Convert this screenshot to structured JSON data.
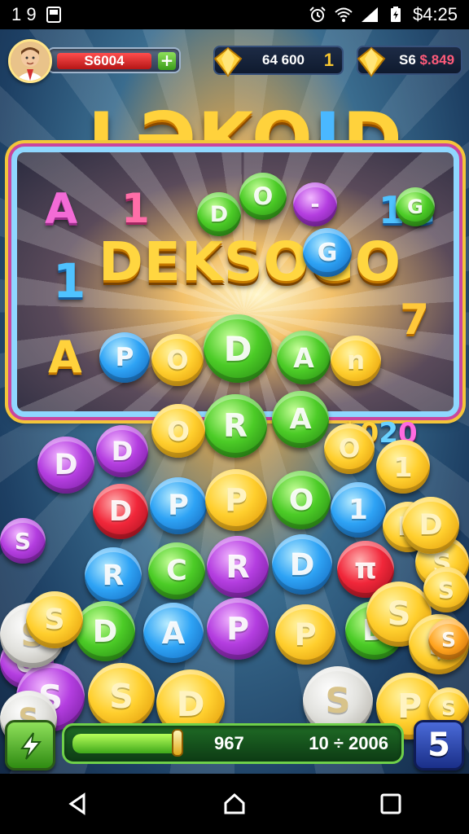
{
  "status_bar": {
    "time_left": "1 9",
    "time_right": "$4:25"
  },
  "hud": {
    "cash_value": "S6004",
    "resource_1_value": "64 600",
    "resource_1_extra": "1",
    "resource_2_value": "S6",
    "resource_2_extra": "$.849"
  },
  "title": {
    "main": "LƏKO",
    "accent": "I",
    "end": "D"
  },
  "board": {
    "word": "DEKSOGO",
    "letters": {
      "A1": "A",
      "one_a": "1",
      "one_b": "1",
      "oneG": "1G",
      "A2": "A",
      "seven": "7"
    }
  },
  "score_badge": {
    "a": "$0",
    "b": "2",
    "c": "0"
  },
  "coins": [
    {
      "id": "c1",
      "color": "green",
      "label": "D"
    },
    {
      "id": "c2",
      "color": "green",
      "label": "O"
    },
    {
      "id": "c3",
      "color": "purple",
      "label": "-"
    },
    {
      "id": "c4",
      "color": "green",
      "label": "G"
    },
    {
      "id": "c5",
      "color": "blue",
      "label": "G"
    },
    {
      "id": "c6",
      "color": "blue",
      "label": "P"
    },
    {
      "id": "c7",
      "color": "gold",
      "label": "O"
    },
    {
      "id": "c8",
      "color": "green",
      "label": "D"
    },
    {
      "id": "c9",
      "color": "green",
      "label": "A"
    },
    {
      "id": "c10",
      "color": "gold",
      "label": "n"
    },
    {
      "id": "c11",
      "color": "green",
      "label": "R"
    },
    {
      "id": "c12",
      "color": "green",
      "label": "A"
    },
    {
      "id": "c13",
      "color": "gold",
      "label": "O"
    },
    {
      "id": "c14",
      "color": "purple",
      "label": "D"
    },
    {
      "id": "c15",
      "color": "gold",
      "label": "O"
    },
    {
      "id": "c16",
      "color": "purple",
      "label": "D"
    },
    {
      "id": "c17",
      "color": "gold",
      "label": "1"
    },
    {
      "id": "c18",
      "color": "red",
      "label": "D"
    },
    {
      "id": "c19",
      "color": "blue",
      "label": "P"
    },
    {
      "id": "c20",
      "color": "gold",
      "label": "P"
    },
    {
      "id": "c21",
      "color": "green",
      "label": "O"
    },
    {
      "id": "c22",
      "color": "blue",
      "label": "1"
    },
    {
      "id": "c23",
      "color": "gold",
      "label": "D"
    },
    {
      "id": "c24",
      "color": "blue",
      "label": "R"
    },
    {
      "id": "c25",
      "color": "green",
      "label": "C"
    },
    {
      "id": "c26",
      "color": "purple",
      "label": "R"
    },
    {
      "id": "c27",
      "color": "blue",
      "label": "D"
    },
    {
      "id": "c28",
      "color": "red",
      "label": "π"
    },
    {
      "id": "c29",
      "color": "green",
      "label": "D"
    },
    {
      "id": "c30",
      "color": "blue",
      "label": "A"
    },
    {
      "id": "c31",
      "color": "purple",
      "label": "P"
    },
    {
      "id": "c32",
      "color": "gold",
      "label": "P"
    },
    {
      "id": "c33",
      "color": "green",
      "label": "D"
    },
    {
      "id": "c34",
      "color": "purple",
      "label": "O"
    },
    {
      "id": "c35",
      "color": "purple",
      "label": "S"
    },
    {
      "id": "c36",
      "color": "gold",
      "label": "S"
    },
    {
      "id": "c37",
      "color": "gold",
      "label": "D"
    },
    {
      "id": "c38",
      "color": "silver",
      "label": "S"
    },
    {
      "id": "c39",
      "color": "gold",
      "label": "P"
    },
    {
      "id": "c40",
      "color": "silver",
      "label": "S"
    },
    {
      "id": "c41",
      "color": "gold",
      "label": "S"
    },
    {
      "id": "c42",
      "color": "gold",
      "label": "S"
    },
    {
      "id": "c43",
      "color": "gold",
      "label": "$"
    },
    {
      "id": "c44",
      "color": "silver",
      "label": "S"
    },
    {
      "id": "c45",
      "color": "gold",
      "label": "S"
    },
    {
      "id": "c46",
      "color": "purple",
      "label": "S"
    },
    {
      "id": "c47",
      "color": "gold",
      "label": "D"
    },
    {
      "id": "c48",
      "color": "orange",
      "label": "S"
    },
    {
      "id": "c49",
      "color": "gold",
      "label": "S"
    },
    {
      "id": "c50",
      "color": "gold",
      "label": "S"
    }
  ],
  "bottom": {
    "progress_fraction": 0.32,
    "progress_value": "967",
    "progress_total": "10 ÷ 2006",
    "level_value": "5"
  }
}
